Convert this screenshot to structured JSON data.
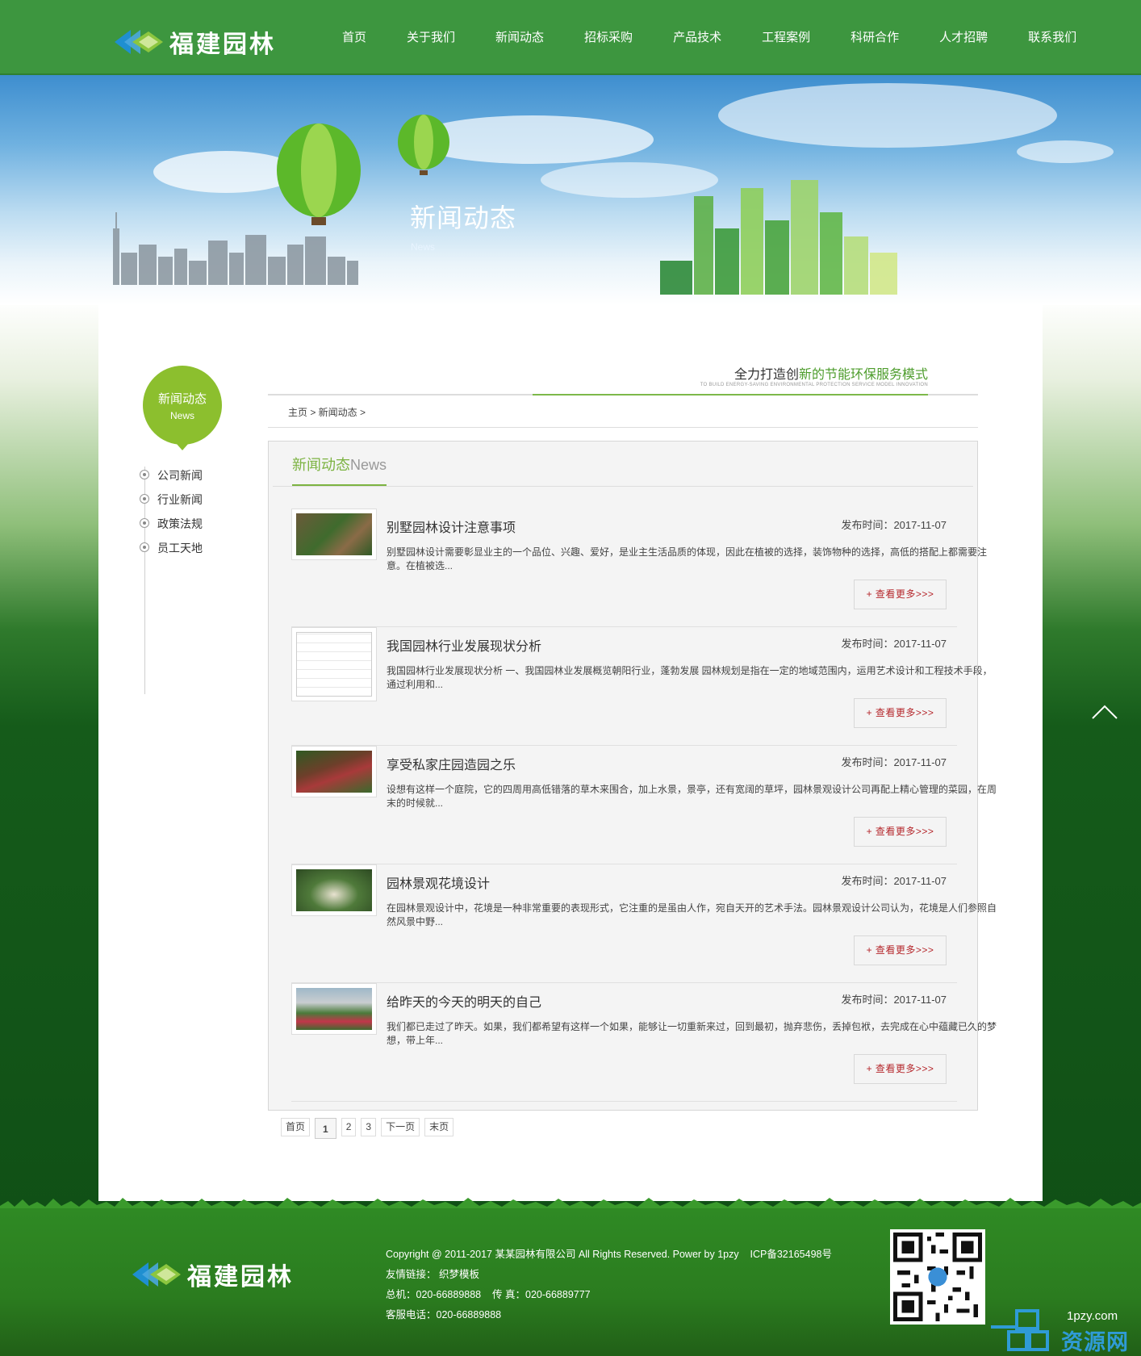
{
  "brand": {
    "name": "福建园林"
  },
  "nav": [
    "首页",
    "关于我们",
    "新闻动态",
    "招标采购",
    "产品技术",
    "工程案例",
    "科研合作",
    "人才招聘",
    "联系我们"
  ],
  "banner": {
    "title": "新闻动态",
    "subtitle": "News"
  },
  "sidebar": {
    "title": "新闻动态",
    "title_en": "News",
    "items": [
      "公司新闻",
      "行业新闻",
      "政策法规",
      "员工天地"
    ]
  },
  "slogan": {
    "prefix": "全力打造创",
    "highlight": "新的节能环保服务模式",
    "english": "TO BUILD ENERGY-SAVING ENVIRONMENTAL PROTECTION SERVICE MODEL INNOVATION"
  },
  "breadcrumb": "主页 > 新闻动态 >",
  "news_section": {
    "title": "新闻动态",
    "title_en": "News"
  },
  "news": [
    {
      "title": "别墅园林设计注意事项",
      "date_label": "发布时间：2017-11-07",
      "desc": "别墅园林设计需要彰显业主的一个品位、兴趣、爱好，是业主生活品质的体现，因此在植被的选择，装饰物种的选择，高低的搭配上都需要注意。在植被选...",
      "more": "+ 查看更多>>>"
    },
    {
      "title": "我国园林行业发展现状分析",
      "date_label": "发布时间：2017-11-07",
      "desc": "我国园林行业发展现状分析 一、我国园林业发展概览朝阳行业，蓬勃发展 园林规划是指在一定的地域范围内，运用艺术设计和工程技术手段，通过利用和...",
      "more": "+ 查看更多>>>"
    },
    {
      "title": "享受私家庄园造园之乐",
      "date_label": "发布时间：2017-11-07",
      "desc": "设想有这样一个庭院，它的四周用高低错落的草木来围合，加上水景，景亭，还有宽阔的草坪，园林景观设计公司再配上精心管理的菜园，在周末的时候就...",
      "more": "+ 查看更多>>>"
    },
    {
      "title": "园林景观花境设计",
      "date_label": "发布时间：2017-11-07",
      "desc": "在园林景观设计中，花境是一种非常重要的表现形式，它注重的是虽由人作，宛自天开的艺术手法。园林景观设计公司认为，花境是人们参照自然风景中野...",
      "more": "+ 查看更多>>>"
    },
    {
      "title": "给昨天的今天的明天的自己",
      "date_label": "发布时间：2017-11-07",
      "desc": "我们都已走过了昨天。如果，我们都希望有这样一个如果，能够让一切重新来过，回到最初，抛弃悲伤，丢掉包袱，去完成在心中蕴藏已久的梦想，带上年...",
      "more": "+ 查看更多>>>"
    }
  ],
  "pagination": [
    "首页",
    "1",
    "2",
    "3",
    "下一页",
    "末页"
  ],
  "footer": {
    "copyright": "Copyright @ 2011-2017 某某园林有限公司 All Rights Reserved. Power by 1pzy    ICP备32165498号",
    "links": "友情链接： 织梦模板",
    "phones": "总机：020-66889888    传 真：020-66889777",
    "service": "客服电话：020-66889888"
  },
  "watermark": {
    "top": "1pzy.com",
    "bottom": "资源网"
  },
  "colors": {
    "header_green": "#3d963f",
    "accent_green": "#8cbf2e",
    "more_red": "#b5272c"
  }
}
